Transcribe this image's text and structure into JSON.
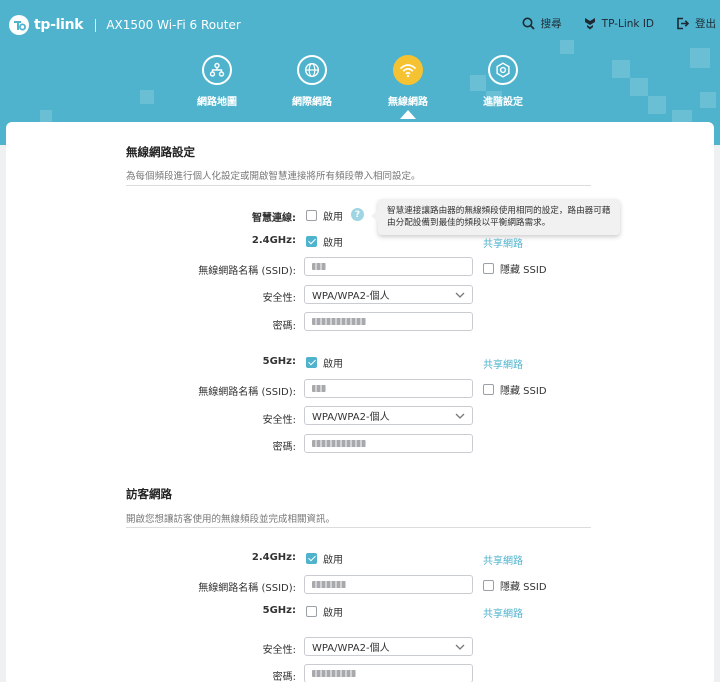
{
  "header": {
    "brand": "tp-link",
    "model": "AX1500 Wi-Fi 6 Router",
    "actions": [
      {
        "label": "搜尋",
        "icon": "search-icon"
      },
      {
        "label": "TP-Link ID",
        "icon": "tplink-id-icon"
      },
      {
        "label": "登出",
        "icon": "logout-icon"
      }
    ]
  },
  "nav": {
    "items": [
      {
        "label": "網路地圖",
        "icon": "network-map-icon"
      },
      {
        "label": "網際網路",
        "icon": "globe-icon"
      },
      {
        "label": "無線網路",
        "icon": "wifi-icon",
        "active": true
      },
      {
        "label": "進階設定",
        "icon": "gear-icon"
      }
    ]
  },
  "wireless": {
    "title": "無線網路設定",
    "desc": "為每個頻段進行個人化設定或開啟智慧連接將所有頻段帶入相同設定。",
    "smart_connect_label": "智慧連線:",
    "smart_connect_checked": false,
    "tooltip": "智慧連接讓路由器的無線頻段使用相同的設定，路由器可藉由分配設備到最佳的頻段以平衡網路需求。",
    "bands": [
      {
        "band_label": "2.4GHz:",
        "enabled": true
      },
      {
        "band_label": "5GHz:",
        "enabled": true
      }
    ]
  },
  "guest": {
    "title": "訪客網路",
    "desc": "開啟您想讓訪客使用的無線頻段並完成相關資訊。",
    "band_24_label": "2.4GHz:",
    "band_24_enabled": true,
    "band_5_label": "5GHz:",
    "band_5_enabled": false
  },
  "labels": {
    "enable": "啟用",
    "ssid": "無線網路名稱 (SSID):",
    "security": "安全性:",
    "password": "密碼:",
    "share_network": "共享網路",
    "hide_ssid": "隱藏 SSID",
    "security_value": "WPA/WPA2-個人"
  },
  "colors": {
    "header": "#4fb3cd",
    "accent": "#4fb3cd",
    "active_nav": "#f5c232"
  }
}
